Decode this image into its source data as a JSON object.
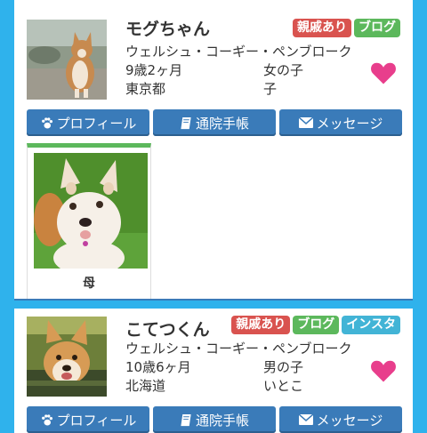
{
  "dogs": [
    {
      "name": "モグちゃん",
      "badges": [
        "親戚あり",
        "ブログ"
      ],
      "breed": "ウェルシュ・コーギー・ペンブローク",
      "age": "9歳2ヶ月",
      "gender": "女の子",
      "location": "東京都",
      "relation": "子",
      "buttons": {
        "profile": "プロフィール",
        "clinic": "通院手帳",
        "message": "メッセージ"
      },
      "family": [
        {
          "label": "母"
        }
      ]
    },
    {
      "name": "こてつくん",
      "badges": [
        "親戚あり",
        "ブログ",
        "インスタ"
      ],
      "breed": "ウェルシュ・コーギー・ペンブローク",
      "age": "10歳6ヶ月",
      "gender": "男の子",
      "location": "北海道",
      "relation": "いとこ",
      "buttons": {
        "profile": "プロフィール",
        "clinic": "通院手帳",
        "message": "メッセージ"
      }
    }
  ],
  "colors": {
    "background": "#2fb2ec",
    "button": "#3a7bb9",
    "heart": "#e83e8c",
    "badge_red": "#d9534f",
    "badge_green": "#5cb85c",
    "badge_cyan": "#42b4d6"
  }
}
